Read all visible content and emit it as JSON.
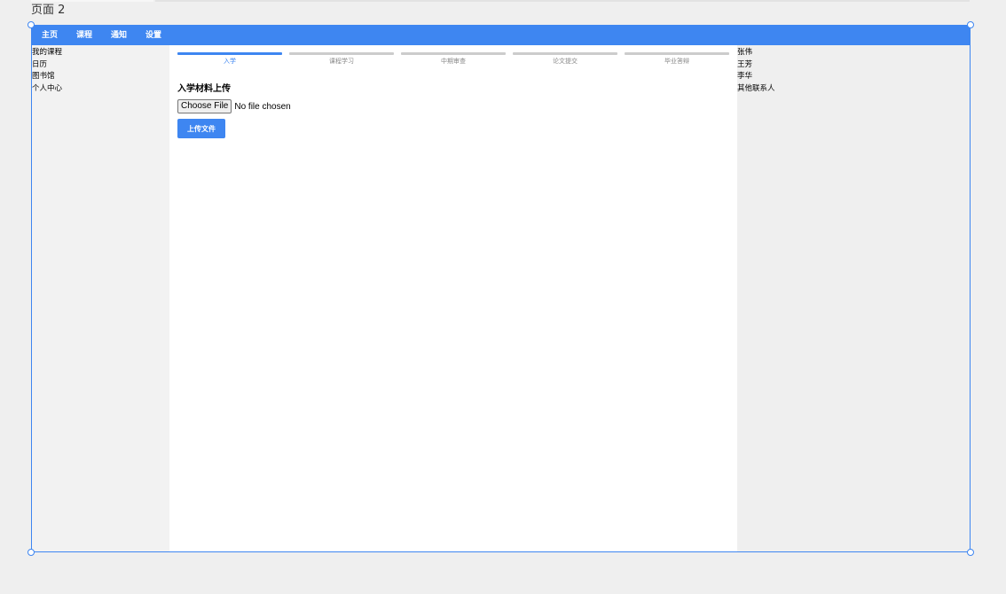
{
  "canvas": {
    "page_label": "页面 2"
  },
  "navbar": {
    "items": [
      {
        "label": "主页"
      },
      {
        "label": "课程"
      },
      {
        "label": "通知"
      },
      {
        "label": "设置"
      }
    ]
  },
  "left_sidebar": {
    "items": [
      {
        "label": "我的课程"
      },
      {
        "label": "日历"
      },
      {
        "label": "图书馆"
      },
      {
        "label": "个人中心"
      }
    ]
  },
  "steps": {
    "items": [
      {
        "label": "入学",
        "active": true
      },
      {
        "label": "课程学习",
        "active": false
      },
      {
        "label": "中期审查",
        "active": false
      },
      {
        "label": "论文提交",
        "active": false
      },
      {
        "label": "毕业答辩",
        "active": false
      }
    ]
  },
  "upload": {
    "title": "入学材料上传",
    "choose_label": "Choose File",
    "file_status": "No file chosen",
    "button_label": "上传文件"
  },
  "right_sidebar": {
    "contacts": [
      {
        "label": "张伟"
      },
      {
        "label": "王芳"
      },
      {
        "label": "李华"
      },
      {
        "label": "其他联系人"
      }
    ]
  },
  "colors": {
    "accent": "#3e86f1",
    "inactive_step": "#cccccc",
    "sidebar_bg": "#f2f2f2",
    "canvas_bg": "#efefef"
  }
}
